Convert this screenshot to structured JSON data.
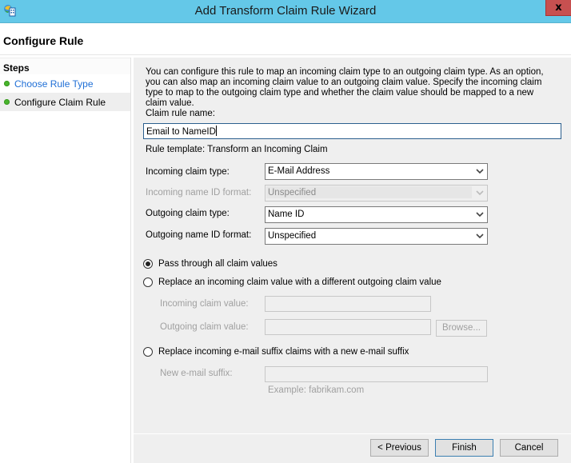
{
  "window": {
    "title": "Add Transform Claim Rule Wizard",
    "icon": "adfs-app-icon",
    "close_label": "x"
  },
  "header": {
    "page_title": "Configure Rule"
  },
  "steps": {
    "heading": "Steps",
    "items": [
      {
        "label": "Choose Rule Type",
        "state": "completed-link"
      },
      {
        "label": "Configure Claim Rule",
        "state": "current"
      }
    ]
  },
  "main": {
    "description": "You can configure this rule to map an incoming claim type to an outgoing claim type. As an option, you can also map an incoming claim value to an outgoing claim value. Specify the incoming claim type to map to the outgoing claim type and whether the claim value should be mapped to a new claim value.",
    "claim_rule_name_label": "Claim rule name:",
    "claim_rule_name_value": "Email to NameID",
    "rule_template": "Rule template: Transform an Incoming Claim",
    "incoming_claim_type_label": "Incoming claim type:",
    "incoming_claim_type_value": "E-Mail Address",
    "incoming_name_id_format_label": "Incoming name ID format:",
    "incoming_name_id_format_value": "Unspecified",
    "outgoing_claim_type_label": "Outgoing claim type:",
    "outgoing_claim_type_value": "Name ID",
    "outgoing_name_id_format_label": "Outgoing name ID format:",
    "outgoing_name_id_format_value": "Unspecified",
    "options": [
      {
        "label": "Pass through all claim values",
        "selected": true
      },
      {
        "label": "Replace an incoming claim value with a different outgoing claim value",
        "selected": false
      },
      {
        "label": "Replace incoming e-mail suffix claims with a new e-mail suffix",
        "selected": false
      }
    ],
    "incoming_claim_value_label": "Incoming claim value:",
    "incoming_claim_value": "",
    "outgoing_claim_value_label": "Outgoing claim value:",
    "outgoing_claim_value": "",
    "browse_label": "Browse...",
    "new_email_suffix_label": "New e-mail suffix:",
    "new_email_suffix_value": "",
    "example_text": "Example: fabrikam.com"
  },
  "footer": {
    "previous_label": "< Previous",
    "finish_label": "Finish",
    "cancel_label": "Cancel"
  }
}
